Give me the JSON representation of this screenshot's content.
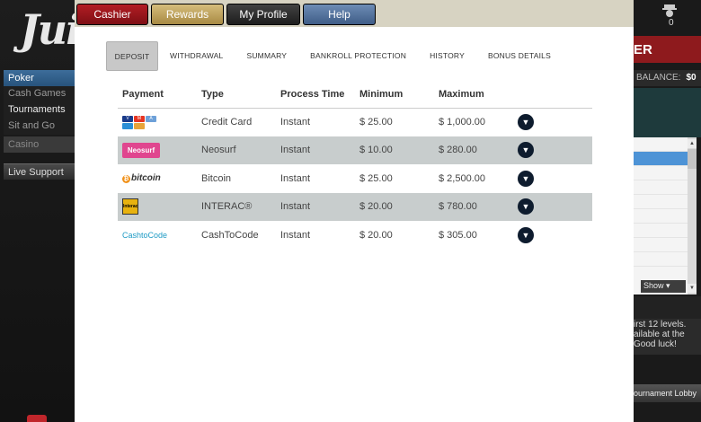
{
  "background": {
    "logo_text": "Jui",
    "nav": {
      "header": "Poker",
      "items": [
        "Cash Games",
        "Tournaments",
        "Sit and Go"
      ],
      "active_item": "Tournaments",
      "casino": "Casino",
      "live_support": "Live Support"
    },
    "right": {
      "user_count": "0",
      "banner": "ER",
      "balance_label": "BALANCE:",
      "balance_value": "$0",
      "show_label": "Show",
      "promo_lines": [
        "irst 12 levels.",
        "ailable at the",
        "Good luck!"
      ],
      "lobby_button": "ournament Lobby"
    }
  },
  "top_tabs": [
    {
      "label": "Cashier"
    },
    {
      "label": "Rewards"
    },
    {
      "label": "My Profile"
    },
    {
      "label": "Help"
    }
  ],
  "subnav": [
    {
      "label": "DEPOSIT",
      "active": true
    },
    {
      "label": "WITHDRAWAL"
    },
    {
      "label": "SUMMARY"
    },
    {
      "label": "BANKROLL PROTECTION"
    },
    {
      "label": "HISTORY"
    },
    {
      "label": "BONUS DETAILS"
    }
  ],
  "table": {
    "headers": [
      "Payment",
      "Type",
      "Process Time",
      "Minimum",
      "Maximum"
    ],
    "rows": [
      {
        "logo": "credit-card",
        "type": "Credit Card",
        "process": "Instant",
        "min": "$ 25.00",
        "max": "$ 1,000.00"
      },
      {
        "logo": "neosurf",
        "logo_text": "Neosurf",
        "type": "Neosurf",
        "process": "Instant",
        "min": "$ 10.00",
        "max": "$ 280.00"
      },
      {
        "logo": "bitcoin",
        "logo_text": "bitcoin",
        "type": "Bitcoin",
        "process": "Instant",
        "min": "$ 25.00",
        "max": "$ 2,500.00"
      },
      {
        "logo": "interac",
        "logo_text": "Interac",
        "type": "INTERAC®",
        "process": "Instant",
        "min": "$ 20.00",
        "max": "$ 780.00"
      },
      {
        "logo": "cashtocode",
        "logo_text": "CashtoCode",
        "type": "CashToCode",
        "process": "Instant",
        "min": "$ 20.00",
        "max": "$ 305.00"
      }
    ]
  },
  "colors": {
    "cashier": "#9e1a20",
    "rewards": "#c2a55f",
    "profile": "#2b2b2b",
    "help": "#52719c",
    "row_alt": "#c8cdcd",
    "chevron": "#0e1c2e"
  }
}
